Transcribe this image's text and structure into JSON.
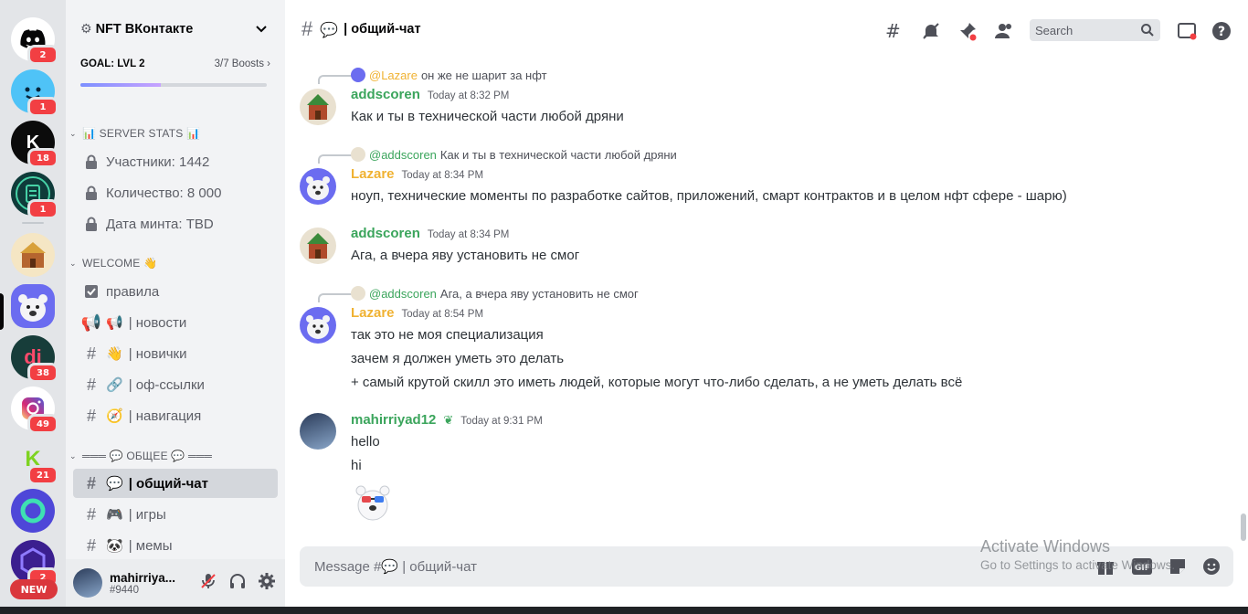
{
  "rail": {
    "servers": [
      {
        "name": "discord-home",
        "badge": "2",
        "color": "#5865f2"
      },
      {
        "name": "blue-smiley",
        "badge": "1",
        "color": "#4fc3f7"
      },
      {
        "name": "k-server",
        "badge": "18",
        "color": "#0b0b0b"
      },
      {
        "name": "clipboard-server",
        "badge": "1",
        "color": "#0f3b3a"
      },
      {
        "name": "temple-server",
        "badge": "",
        "color": "#f5e6c4"
      },
      {
        "name": "bear-server",
        "badge": "",
        "color": "#6b6cf0"
      },
      {
        "name": "di-server",
        "badge": "38",
        "color": "#173d3a"
      },
      {
        "name": "instagram-server",
        "badge": "49",
        "color": "#ffffff"
      },
      {
        "name": "green-k-server",
        "badge": "21",
        "color": "#e3e5e8"
      },
      {
        "name": "green-ring-server",
        "badge": "",
        "color": "#4e47d8"
      },
      {
        "name": "purple-hex-server",
        "badge": "2",
        "color": "#3b1f8f"
      }
    ],
    "new_label": "NEW"
  },
  "sidebar": {
    "server_name": "NFT ВКонтакте",
    "goal": "GOAL: LVL 2",
    "boosts": "3/7 Boosts",
    "boost_progress": 0.43,
    "categories": [
      {
        "label": "📊 SERVER STATS 📊"
      },
      {
        "label": "WELCOME 👋"
      },
      {
        "label": "═══ 💬 ОБЩЕЕ 💬 ═══"
      }
    ],
    "stats": [
      {
        "label": "Участники: 1442"
      },
      {
        "label": "Количество: 8 000"
      },
      {
        "label": "Дата минта: TBD"
      }
    ],
    "welcome": [
      {
        "emoji": "",
        "label": "правила"
      },
      {
        "emoji": "📢",
        "label": "| новости"
      },
      {
        "emoji": "👋",
        "label": "| новички"
      },
      {
        "emoji": "🔗",
        "label": "| оф-ссылки"
      },
      {
        "emoji": "🧭",
        "label": "| навигация"
      }
    ],
    "general": [
      {
        "emoji": "💬",
        "label": "| общий-чат"
      },
      {
        "emoji": "🎮",
        "label": "| игры"
      },
      {
        "emoji": "🐼",
        "label": "| мемы"
      }
    ]
  },
  "user": {
    "name": "mahirriya...",
    "tag": "#9440"
  },
  "header": {
    "channel_emoji": "💬",
    "channel_name": "| общий-чат",
    "search_placeholder": "Search"
  },
  "messages": [
    {
      "reply_to": "@Lazare",
      "reply_text": "он же не шарит за нфт",
      "author": "addscoren",
      "author_color": "#3ba55c",
      "time": "Today at 8:32 PM",
      "lines": [
        "Как и ты в технической части любой дряни"
      ]
    },
    {
      "reply_to": "@addscoren",
      "reply_text": "Как и ты в технической части любой дряни",
      "author": "Lazare",
      "author_color": "#f0b232",
      "time": "Today at 8:34 PM",
      "lines": [
        "ноуп, технические моменты по разработке сайтов, приложений, смарт контрактов и в целом нфт сфере - шарю)"
      ]
    },
    {
      "author": "addscoren",
      "author_color": "#3ba55c",
      "time": "Today at 8:34 PM",
      "lines": [
        "Ага, а вчера яву установить не смог"
      ]
    },
    {
      "reply_to": "@addscoren",
      "reply_text": "Ага, а вчера яву установить не смог",
      "author": "Lazare",
      "author_color": "#f0b232",
      "time": "Today at 8:54 PM",
      "lines": [
        "так это не моя специализация",
        "зачем я должен уметь это делать",
        "+ самый крутой скилл это иметь людей, которые могут что-либо сделать, а не уметь делать всё"
      ]
    },
    {
      "author": "mahirriyad12",
      "author_color": "#3ba55c",
      "time": "Today at 9:31 PM",
      "lines": [
        "hello",
        "hi"
      ]
    }
  ],
  "composer": {
    "placeholder": "Message #💬 | общий-чат"
  },
  "watermark": {
    "line1": "Activate Windows",
    "line2": "Go to Settings to activate Windows."
  }
}
